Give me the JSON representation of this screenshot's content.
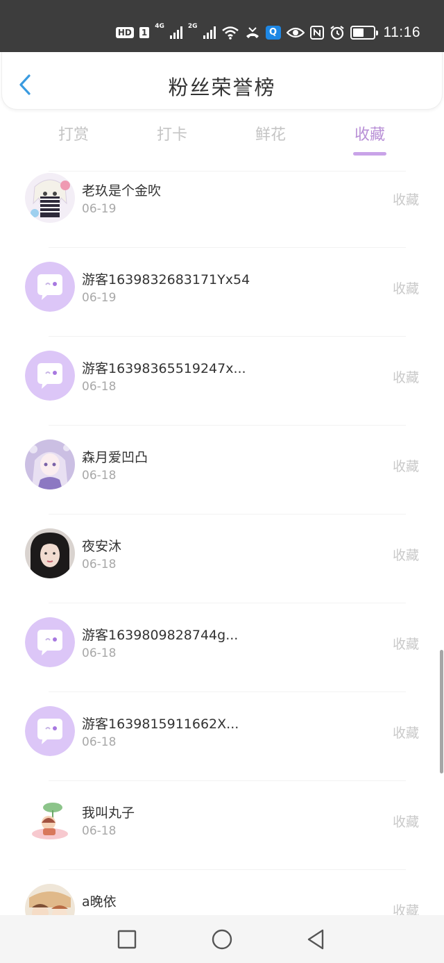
{
  "status_bar": {
    "hd": "HD",
    "sim": "1",
    "net1": "4G",
    "net2": "2G",
    "search_badge": "Q",
    "time": "11:16"
  },
  "header": {
    "back_icon": "chevron-left-icon",
    "title": "粉丝荣誉榜"
  },
  "tabs": [
    {
      "label": "打赏",
      "active": false
    },
    {
      "label": "打卡",
      "active": false
    },
    {
      "label": "鲜花",
      "active": false
    },
    {
      "label": "收藏",
      "active": true
    }
  ],
  "list": [
    {
      "name": "老玖是个金吹",
      "date": "06-19",
      "action": "收藏",
      "avatar": "anime-girl-avatar"
    },
    {
      "name": "游客1639832683171Yx54",
      "date": "06-19",
      "action": "收藏",
      "avatar": "default-chat-avatar"
    },
    {
      "name": "游客16398365519247x...",
      "date": "06-18",
      "action": "收藏",
      "avatar": "default-chat-avatar"
    },
    {
      "name": "森月爱凹凸",
      "date": "06-18",
      "action": "收藏",
      "avatar": "anime-girl-avatar"
    },
    {
      "name": "夜安沐",
      "date": "06-18",
      "action": "收藏",
      "avatar": "photo-avatar"
    },
    {
      "name": "游客1639809828744g...",
      "date": "06-18",
      "action": "收藏",
      "avatar": "default-chat-avatar"
    },
    {
      "name": "游客1639815911662X...",
      "date": "06-18",
      "action": "收藏",
      "avatar": "default-chat-avatar"
    },
    {
      "name": "我叫丸子",
      "date": "06-18",
      "action": "收藏",
      "avatar": "cartoon-avatar"
    },
    {
      "name": "a晚依",
      "date": "",
      "action": "收藏",
      "avatar": "anime-avatar"
    }
  ],
  "colors": {
    "accent": "#b88fd6",
    "default_avatar_bg": "#dcc6f7",
    "status_bar_bg": "#3d3d3d",
    "back_icon": "#3a9be0"
  },
  "nav": {
    "recents_icon": "square-icon",
    "home_icon": "circle-icon",
    "back_icon": "triangle-back-icon"
  }
}
